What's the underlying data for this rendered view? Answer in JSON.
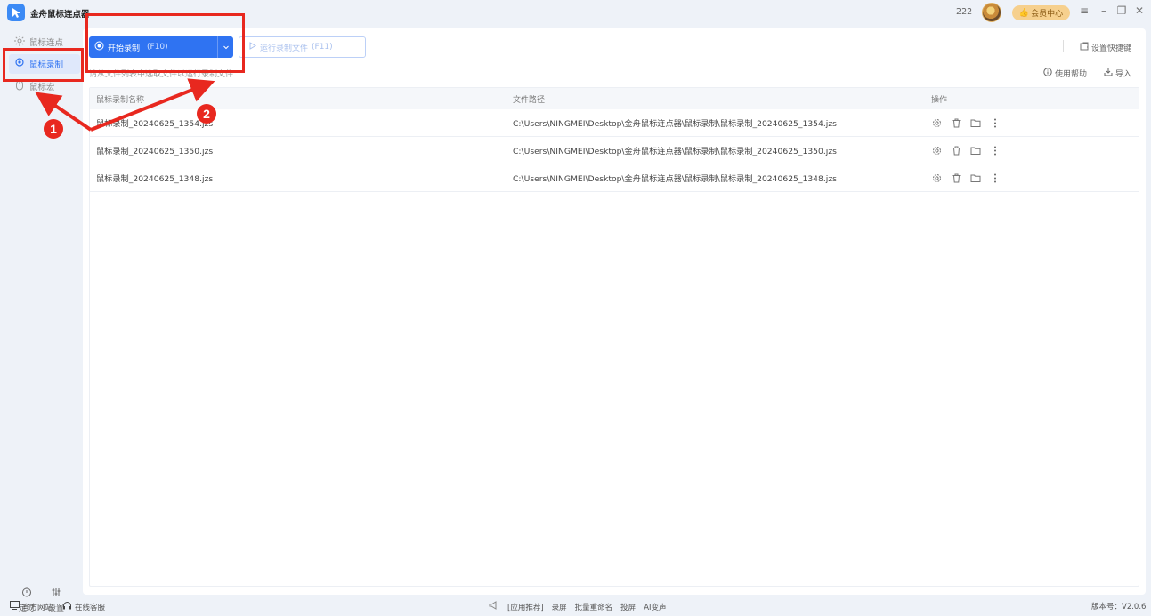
{
  "app": {
    "title": "金舟鼠标连点器",
    "points": "222",
    "vip_label": "会员中心",
    "version_label": "版本号：V2.0.6"
  },
  "sidebar": {
    "items": [
      {
        "label": "鼠标连点",
        "icon": "click-icon",
        "active": false
      },
      {
        "label": "鼠标录制",
        "icon": "record-icon",
        "active": true
      },
      {
        "label": "鼠标宏",
        "icon": "mouse-icon",
        "active": false
      }
    ],
    "bottom": [
      {
        "label": "定时",
        "icon": "timer-icon"
      },
      {
        "label": "设置",
        "icon": "sliders-icon"
      }
    ]
  },
  "toolbar": {
    "start_label": "开始录制",
    "start_key": "(F10)",
    "run_label": "运行录制文件",
    "run_key": "(F11)",
    "hint": "请从文件列表中选取文件以运行录制文件",
    "shortcut_label": "设置快捷键",
    "help_label": "使用帮助",
    "import_label": "导入"
  },
  "table": {
    "headers": [
      "鼠标录制名称",
      "文件路径",
      "操作"
    ],
    "rows": [
      {
        "name": "鼠标录制_20240625_1354.jzs",
        "path": "C:\\Users\\NINGMEI\\Desktop\\金舟鼠标连点器\\鼠标录制\\鼠标录制_20240625_1354.jzs"
      },
      {
        "name": "鼠标录制_20240625_1350.jzs",
        "path": "C:\\Users\\NINGMEI\\Desktop\\金舟鼠标连点器\\鼠标录制\\鼠标录制_20240625_1350.jzs"
      },
      {
        "name": "鼠标录制_20240625_1348.jzs",
        "path": "C:\\Users\\NINGMEI\\Desktop\\金舟鼠标连点器\\鼠标录制\\鼠标录制_20240625_1348.jzs"
      }
    ],
    "op_icons": [
      "settings-icon",
      "trash-icon",
      "folder-icon",
      "more-icon"
    ]
  },
  "statusbar": {
    "website": "官方网站",
    "service": "在线客服",
    "promo": "[应用推荐]",
    "links": [
      "录屏",
      "批量重命名",
      "投屏",
      "AI变声"
    ]
  },
  "annotations": {
    "badge1": "1",
    "badge2": "2",
    "color": "#e8281f"
  },
  "colors": {
    "accent": "#2f73f2",
    "vip": "#f6d08e"
  }
}
